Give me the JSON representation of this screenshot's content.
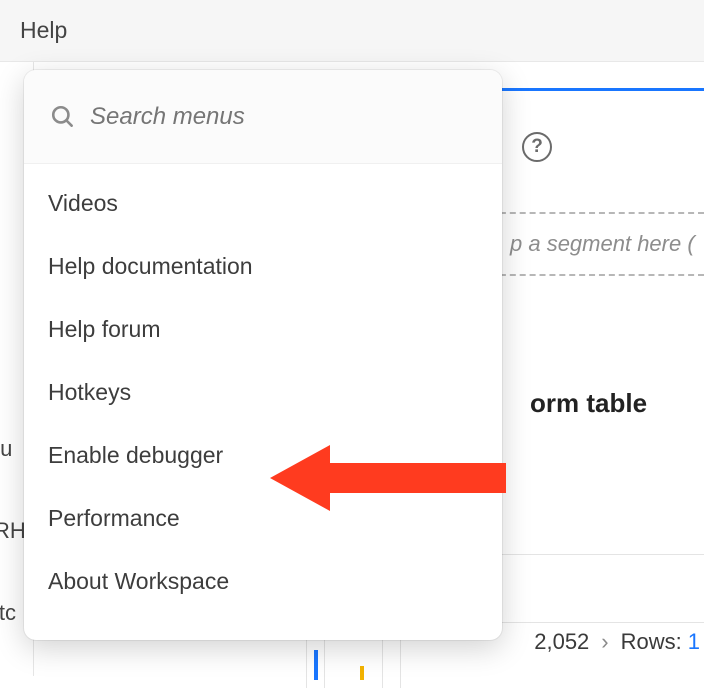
{
  "topbar": {
    "help": "Help"
  },
  "side": {
    "l1": "tu",
    "l2": "RH",
    "l3": "itc"
  },
  "help_icon_text": "?",
  "segment_hint": "p a segment here (",
  "form_title": "orm table",
  "footer": {
    "count": "2,052",
    "rows_label": "Rows:",
    "rows_n": "1"
  },
  "menu": {
    "search_placeholder": "Search menus",
    "items": [
      "Videos",
      "Help documentation",
      "Help forum",
      "Hotkeys",
      "Enable debugger",
      "Performance",
      "About Workspace"
    ]
  }
}
